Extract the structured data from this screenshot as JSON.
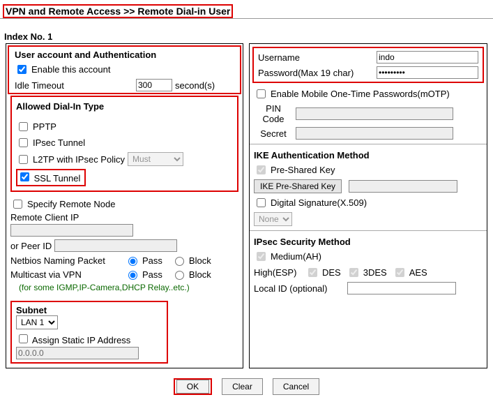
{
  "title": "VPN and Remote Access >> Remote Dial-in User",
  "index_label": "Index No. 1",
  "left": {
    "auth_heading": "User account and Authentication",
    "enable_label": "Enable this account",
    "idle_label": "Idle Timeout",
    "idle_value": "300",
    "idle_unit": "second(s)",
    "allowed_heading": "Allowed Dial-In Type",
    "pptp": "PPTP",
    "ipsec": "IPsec Tunnel",
    "l2tp": "L2TP with IPsec Policy",
    "l2tp_policy": "Must",
    "ssl": "SSL Tunnel",
    "specify_remote": "Specify Remote Node",
    "remote_ip_label": "Remote Client IP",
    "remote_ip_value": "",
    "or_peer_label": "or Peer ID",
    "peer_id_value": "",
    "netbios_label": "Netbios Naming Packet",
    "multicast_label": "Multicast via VPN",
    "pass": "Pass",
    "block": "Block",
    "hint": "(for some IGMP,IP-Camera,DHCP Relay..etc.)",
    "subnet_heading": "Subnet",
    "subnet_value": "LAN 1",
    "assign_static": "Assign Static IP Address",
    "static_ip_value": "0.0.0.0"
  },
  "right": {
    "username_label": "Username",
    "username_value": "indo",
    "password_label": "Password(Max 19 char)",
    "password_value": "•••••••••",
    "motp_label": "Enable Mobile One-Time Passwords(mOTP)",
    "pin_label": "PIN Code",
    "secret_label": "Secret",
    "ike_heading": "IKE Authentication Method",
    "psk_label": "Pre-Shared Key",
    "ike_btn": "IKE Pre-Shared Key",
    "digsig_label": "Digital Signature(X.509)",
    "digsig_value": "None",
    "ipsec_heading": "IPsec Security Method",
    "medium_label": "Medium(AH)",
    "high_label": "High(ESP)",
    "des": "DES",
    "tdes": "3DES",
    "aes": "AES",
    "localid_label": "Local ID (optional)"
  },
  "buttons": {
    "ok": "OK",
    "clear": "Clear",
    "cancel": "Cancel"
  }
}
